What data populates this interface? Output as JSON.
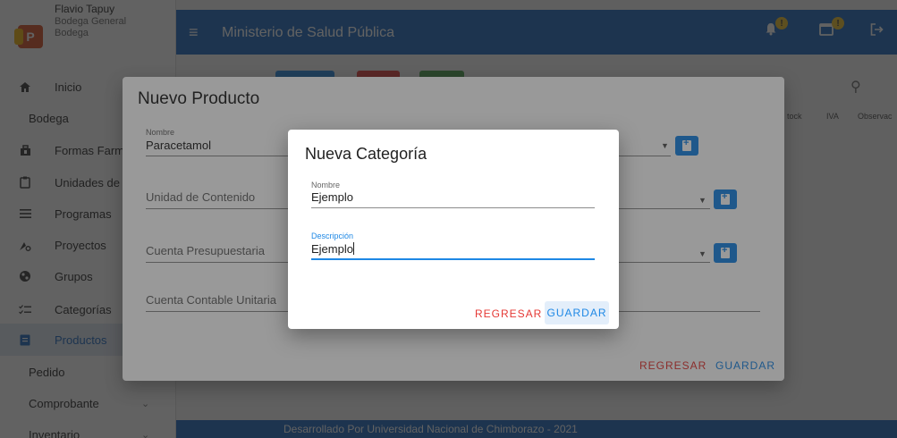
{
  "profile": {
    "name": "Flavio Tapuy",
    "line2": "Bodega General",
    "line3": "Bodega"
  },
  "sidebar": {
    "items": [
      {
        "label": "Inicio",
        "icon": "home-icon"
      },
      {
        "label": "Bodega"
      },
      {
        "label": "Formas Farmaceuticas",
        "icon": "briefcase-icon"
      },
      {
        "label": "Unidades de Contenido",
        "icon": "clipboard-icon"
      },
      {
        "label": "Programas",
        "icon": "menu-lines-icon"
      },
      {
        "label": "Proyectos",
        "icon": "chart-gear-icon"
      },
      {
        "label": "Grupos",
        "icon": "globe-icon"
      },
      {
        "label": "Categorías",
        "icon": "list-check-icon"
      },
      {
        "label": "Productos",
        "icon": "document-icon",
        "active": true
      },
      {
        "label": "Pedido"
      },
      {
        "label": "Comprobante",
        "chevron": "chevron-down-icon"
      },
      {
        "label": "Inventario",
        "chevron": "chevron-down-icon"
      }
    ]
  },
  "appbar": {
    "title": "Ministerio de Salud Pública",
    "bell_badge": "!",
    "calendar_badge": "!"
  },
  "table": {
    "col_stock": "tock",
    "col_iva": "IVA",
    "col_obs": "Observac"
  },
  "footer": {
    "text": "Desarrollado Por Universidad Nacional de Chimborazo - 2021"
  },
  "producto_dialog": {
    "title": "Nuevo Producto",
    "nombre_label": "Nombre",
    "nombre_value": "Paracetamol",
    "unidad_placeholder": "Unidad de Contenido",
    "cuenta_placeholder": "Cuenta Presupuestaria",
    "cuenta_contable_placeholder": "Cuenta Contable Unitaria",
    "regresar_label": "REGRESAR",
    "guardar_label": "GUARDAR"
  },
  "categoria_dialog": {
    "title": "Nueva Categoría",
    "nombre_label": "Nombre",
    "nombre_value": "Ejemplo",
    "descripcion_label": "Descripción",
    "descripcion_value": "Ejemplo",
    "regresar_label": "REGRESAR",
    "guardar_label": "GUARDAR"
  },
  "colors": {
    "primary": "#1565c0",
    "accent": "#1e88e5",
    "danger": "#e53935",
    "active_bg": "#dfe7f3"
  }
}
